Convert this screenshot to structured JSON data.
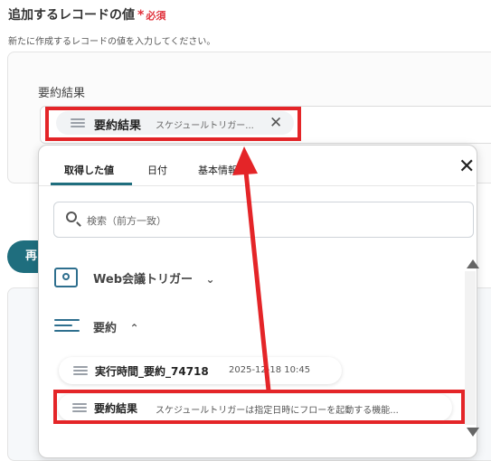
{
  "section": {
    "title": "追加するレコードの値",
    "required_mark": "*",
    "required_text": "必須",
    "description": "新たに作成するレコードの値を入力してください。"
  },
  "field": {
    "label": "要約結果",
    "chip_title": "要約結果",
    "chip_value": "スケジュールトリガー..."
  },
  "background": {
    "pill_label": "再"
  },
  "popup": {
    "tabs": [
      "取得した値",
      "日付",
      "基本情報"
    ],
    "active_tab": "取得した値",
    "search_placeholder": "検索（前方一致）",
    "groups": [
      {
        "title": "Web会議トリガー",
        "icon": "video-meeting-icon",
        "expanded": false
      },
      {
        "title": "要約",
        "icon": "summary-lines-icon",
        "expanded": true
      }
    ],
    "items": [
      {
        "title": "実行時間_要約_74718",
        "value": "2025-12-18 10:45"
      },
      {
        "title": "要約結果",
        "value": "スケジュールトリガーは指定日時にフローを起動する機能..."
      }
    ]
  },
  "colors": {
    "highlight": "#e42528",
    "accent": "#1f6e7e",
    "required": "#e0303a"
  }
}
